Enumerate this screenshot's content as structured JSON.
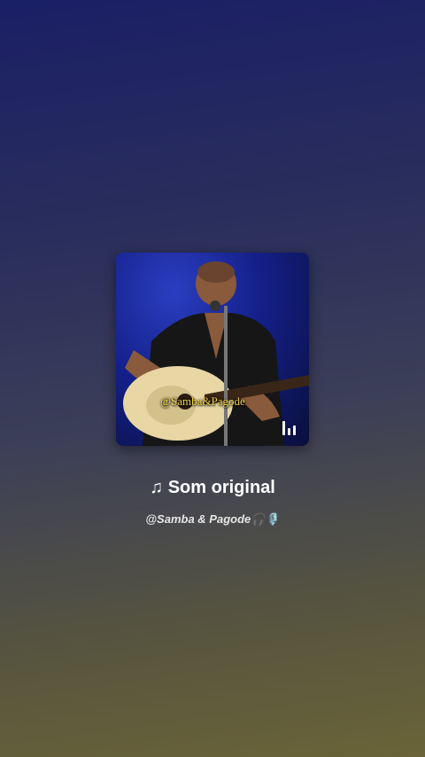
{
  "track": {
    "title": "Som original",
    "title_icon": "music-note-icon",
    "artist": "@Samba & Pagode",
    "artist_emojis": "🎧🎙️"
  },
  "cover": {
    "watermark": "@Samba&Pagode",
    "playing_indicator": "equalizer-icon"
  },
  "colors": {
    "background_top": "#1a1f66",
    "background_bottom": "#6a6438",
    "watermark": "#f1d34a"
  }
}
